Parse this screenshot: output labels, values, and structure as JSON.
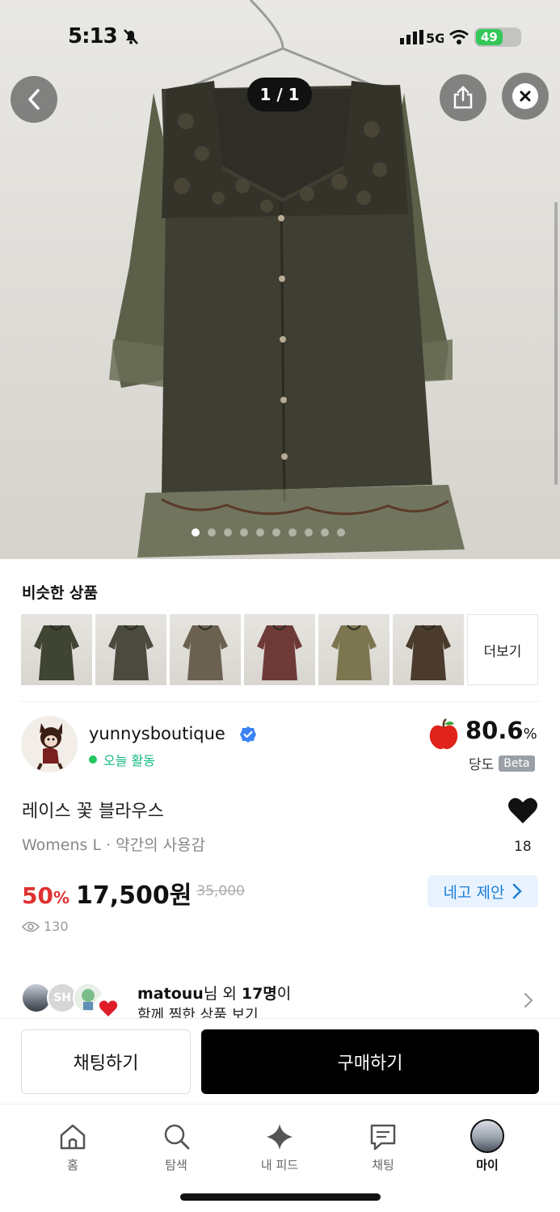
{
  "status_bar": {
    "time": "5:13",
    "battery": "49"
  },
  "hero": {
    "counter": "1 / 1",
    "dots_total": 10,
    "dot_active_index": 0
  },
  "similar": {
    "title": "비슷한 상품",
    "more_label": "더보기",
    "thumb_colors": [
      "#3f4433",
      "#4a4a3e",
      "#6b6150",
      "#6e3a38",
      "#7b7550",
      "#4a3b2c"
    ]
  },
  "seller": {
    "name": "yunnysboutique",
    "activity": "오늘 활동",
    "score_value": "80.6",
    "score_unit": "%",
    "sweet_label": "당도",
    "beta_label": "Beta"
  },
  "product": {
    "title": "레이스 꽃 블라우스",
    "meta": "Womens L · 약간의 사용감",
    "like_count": "18",
    "discount": "50",
    "discount_unit": "%",
    "price": "17,500원",
    "original_price": "35,000",
    "offer_label": "네고 제안",
    "views": "130"
  },
  "coliked": {
    "user": "matouu",
    "suffix1": "님 외 ",
    "count": "17명",
    "suffix2": "이",
    "line2": "함께 찜한 상품 보기",
    "avatar_initials": "SH"
  },
  "actions": {
    "chat_label": "채팅하기",
    "buy_label": "구매하기"
  },
  "tabbar": {
    "items": [
      {
        "label": "홈",
        "icon": "home-icon"
      },
      {
        "label": "탐색",
        "icon": "search-icon"
      },
      {
        "label": "내 피드",
        "icon": "sparkle-icon"
      },
      {
        "label": "채팅",
        "icon": "chat-icon"
      },
      {
        "label": "마이",
        "icon": "avatar"
      }
    ]
  }
}
